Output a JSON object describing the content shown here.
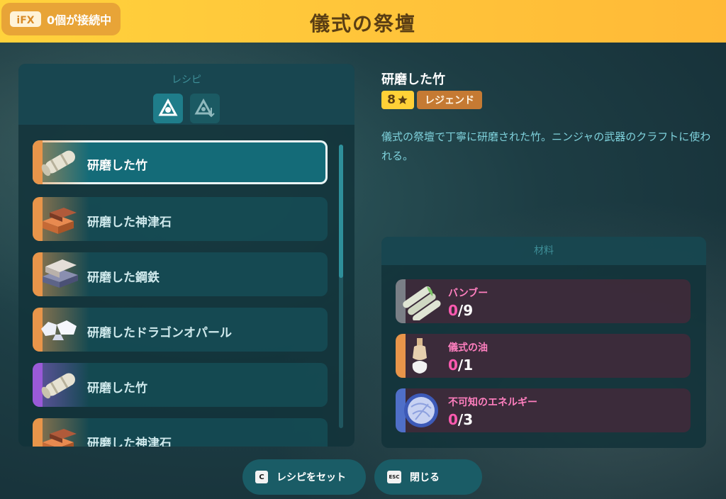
{
  "header": {
    "title": "儀式の祭壇",
    "connection_text": "0個が接続中",
    "logo_text": "iFX"
  },
  "recipe": {
    "header_label": "レシピ",
    "tabs": [
      {
        "icon": "craft-icon",
        "active": true
      },
      {
        "icon": "craft-down-icon",
        "active": false
      }
    ],
    "items": [
      {
        "label": "研磨した竹",
        "icon": "bamboo-icon",
        "rarity_color": "#e8954a",
        "selected": true
      },
      {
        "label": "研磨した神津石",
        "icon": "brick-icon",
        "rarity_color": "#e8954a",
        "selected": false
      },
      {
        "label": "研磨した鋼鉄",
        "icon": "steel-ingot-icon",
        "rarity_color": "#e8954a",
        "selected": false
      },
      {
        "label": "研磨したドラゴンオパール",
        "icon": "opal-icon",
        "rarity_color": "#e8954a",
        "selected": false
      },
      {
        "label": "研磨した竹",
        "icon": "bamboo-icon",
        "rarity_color": "#9a5ad8",
        "selected": false
      },
      {
        "label": "研磨した神津石",
        "icon": "brick-icon",
        "rarity_color": "#e8954a",
        "selected": false
      }
    ]
  },
  "detail": {
    "name": "研磨した竹",
    "stars": "8",
    "rarity": "レジェンド",
    "description": "儀式の祭壇で丁寧に研磨された竹。ニンジャの武器のクラフトに使われる。"
  },
  "materials": {
    "header_label": "材料",
    "items": [
      {
        "name": "バンブー",
        "have": "0",
        "need": "/9",
        "icon": "bamboo-bundle-icon",
        "rarity_color": "#7a7f86"
      },
      {
        "name": "儀式の油",
        "have": "0",
        "need": "/1",
        "icon": "oil-bottle-icon",
        "rarity_color": "#e8954a"
      },
      {
        "name": "不可知のエネルギー",
        "have": "0",
        "need": "/3",
        "icon": "energy-orb-icon",
        "rarity_color": "#4f6fc8"
      }
    ]
  },
  "buttons": {
    "set_recipe": {
      "key": "C",
      "label": "レシピをセット"
    },
    "close": {
      "key": "ESC",
      "label": "閉じる"
    }
  },
  "colors": {
    "header_yellow": "#ffc53a",
    "accent_teal": "#146b78",
    "material_pink": "#ff5ab0",
    "legend_orange": "#c57a33"
  }
}
